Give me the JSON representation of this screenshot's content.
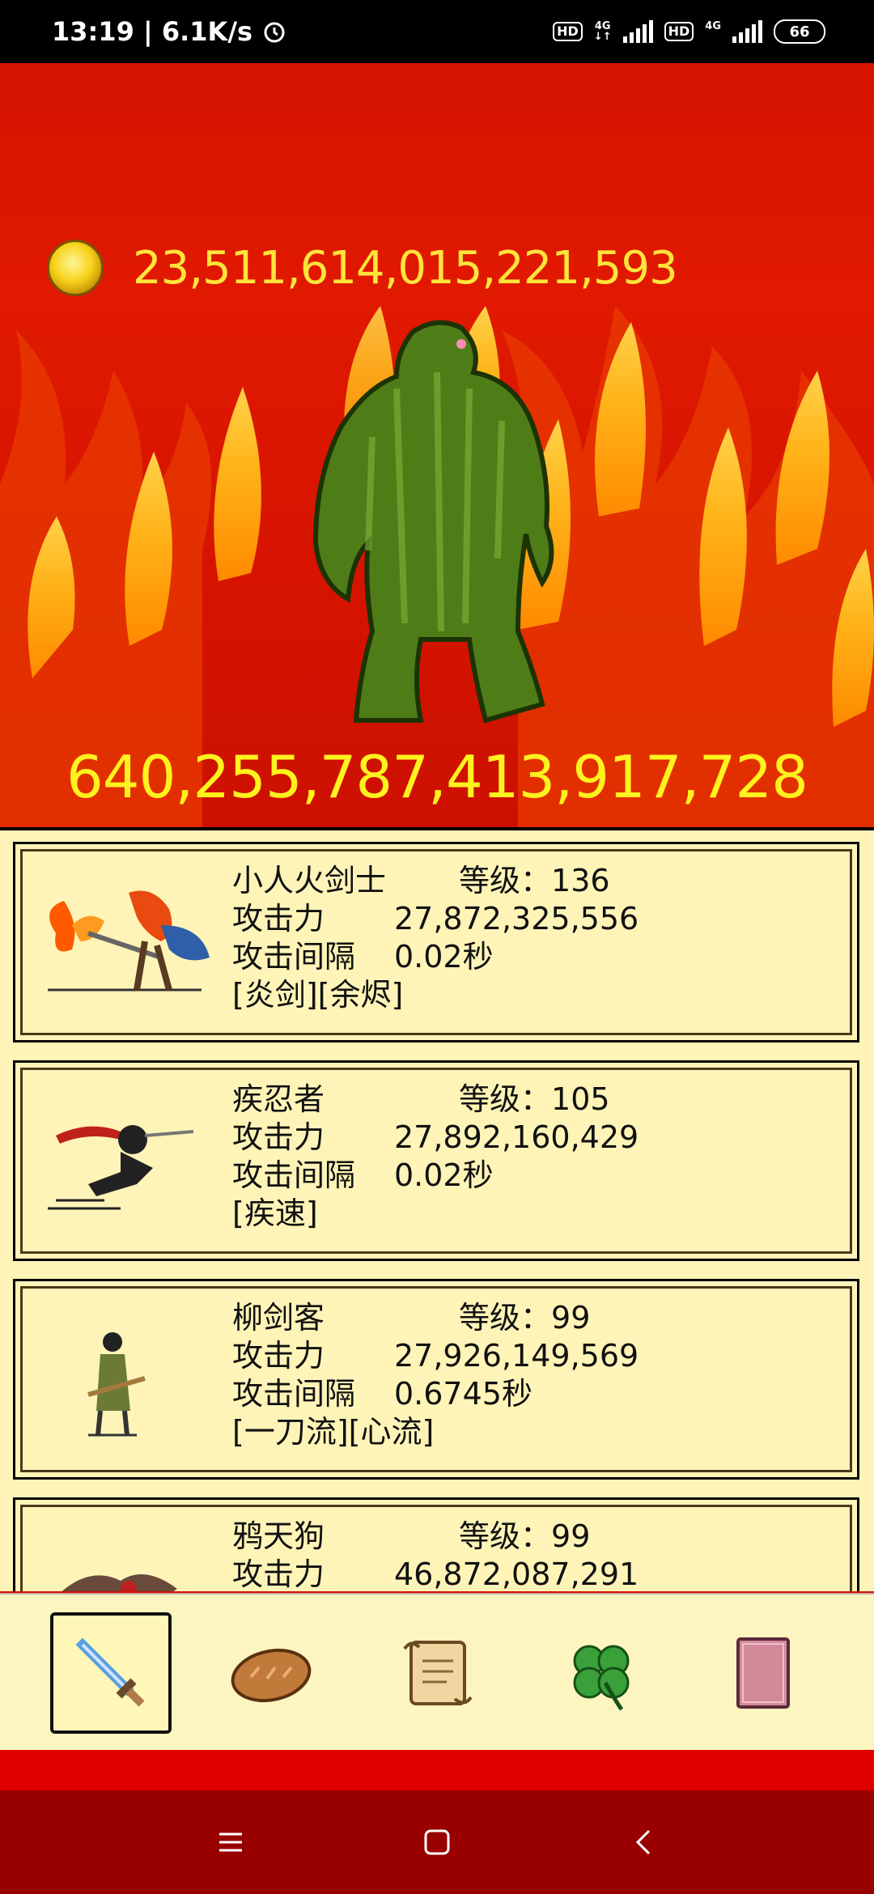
{
  "status_bar": {
    "time_speed": "13:19 | 6.1K/s",
    "net1": "4G",
    "net2": "4G",
    "hd": "HD",
    "battery": "66"
  },
  "gold": {
    "amount": "23,511,614,015,221,593",
    "icon": "gold-coin-icon"
  },
  "enemy": {
    "hp": "640,255,787,413,917,728",
    "icon": "green-swamp-monster"
  },
  "labels": {
    "level": "等级：",
    "attack": "攻击力",
    "interval": "攻击间隔"
  },
  "characters": [
    {
      "name": "小人火剑士",
      "level": "136",
      "attack": "27,872,325,556",
      "interval": "0.02秒",
      "skills": "[炎剑][余烬]"
    },
    {
      "name": "疾忍者",
      "level": "105",
      "attack": "27,892,160,429",
      "interval": "0.02秒",
      "skills": "[疾速]"
    },
    {
      "name": "柳剑客",
      "level": "99",
      "attack": "27,926,149,569",
      "interval": "0.6745秒",
      "skills": "[一刀流][心流]"
    },
    {
      "name": "鸦天狗",
      "level": "99",
      "attack": "46,872,087,291"
    }
  ],
  "tabs": [
    "sword-icon",
    "bread-icon",
    "scroll-icon",
    "clover-icon",
    "book-icon"
  ],
  "colors": {
    "gold_text": "#ffe43a",
    "hp_text": "#fff21e",
    "panel_bg": "#fff4b8",
    "nav_bg": "#990000"
  }
}
